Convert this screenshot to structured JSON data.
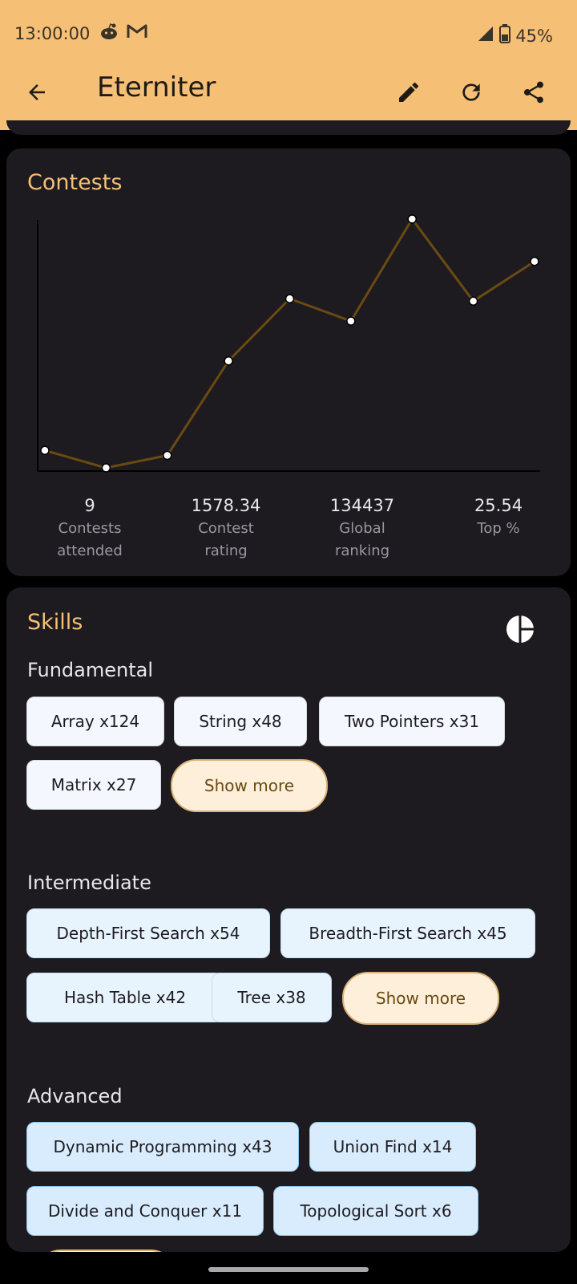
{
  "status_bar": {
    "time": "13:00:00",
    "battery": "45%"
  },
  "app_bar": {
    "title": "Eterniter"
  },
  "contests": {
    "title": "Contests",
    "stats": [
      {
        "value": "9",
        "label": "Contests\nattended"
      },
      {
        "value": "1578.34",
        "label": "Contest\nrating"
      },
      {
        "value": "134437",
        "label": "Global\nranking"
      },
      {
        "value": "25.54",
        "label": "Top %"
      }
    ]
  },
  "chart_data": {
    "type": "line",
    "title": "",
    "xlabel": "",
    "ylabel": "",
    "x": [
      1,
      2,
      3,
      4,
      5,
      6,
      7,
      8,
      9
    ],
    "series": [
      {
        "values": [
          0.07,
          0.0,
          0.05,
          0.43,
          0.68,
          0.59,
          1.0,
          0.67,
          0.83
        ]
      }
    ],
    "ylim": [
      0,
      1
    ],
    "grid": false,
    "colors": {
      "line": "#6b4a12",
      "point_fill": "#ffffff",
      "axis": "#000000"
    }
  },
  "skills": {
    "title": "Skills",
    "groups": [
      {
        "title": "Fundamental",
        "tags": [
          "Array x124",
          "String x48",
          "Two Pointers x31",
          "Matrix x27"
        ],
        "more": "Show more"
      },
      {
        "title": "Intermediate",
        "tags": [
          "Depth-First Search x54",
          "Breadth-First Search x45",
          "Hash Table x42",
          "Tree x38"
        ],
        "more": "Show more"
      },
      {
        "title": "Advanced",
        "tags": [
          "Dynamic Programming x43",
          "Union Find x14",
          "Divide and Conquer x11",
          "Topological Sort x6"
        ]
      }
    ]
  },
  "colors": {
    "app_bar": "#f5bf76",
    "card": "#1d1b20",
    "accent": "#f5bf76",
    "background": "#000000"
  }
}
